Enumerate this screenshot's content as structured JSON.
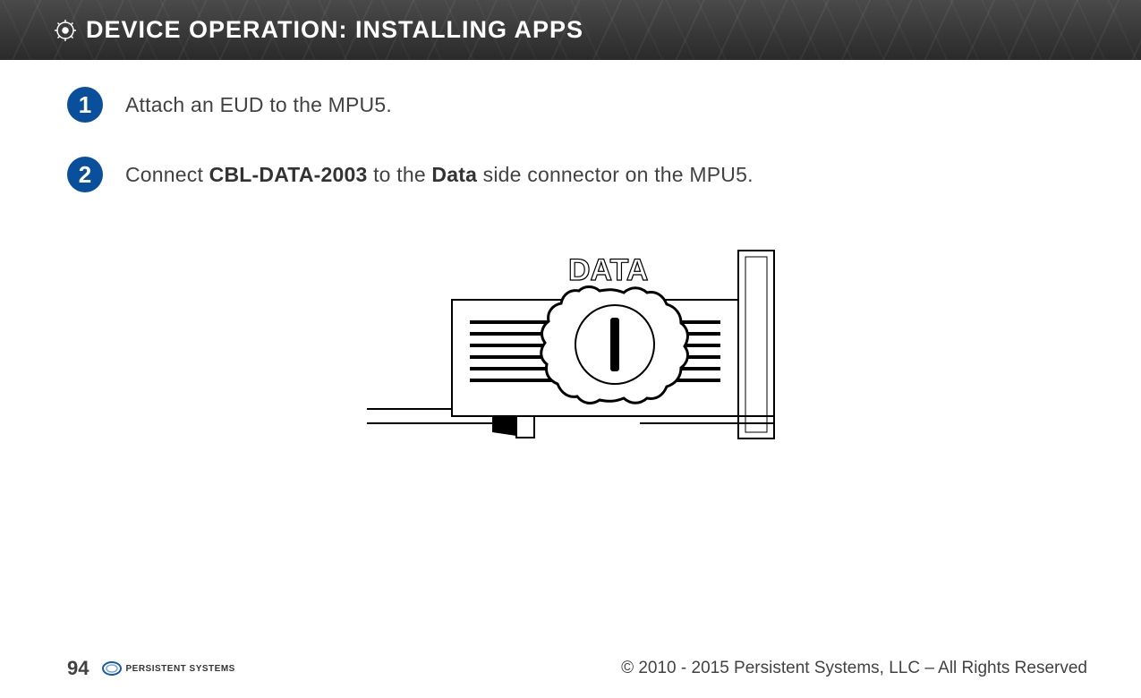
{
  "header": {
    "title": "DEVICE OPERATION:  INSTALLING APPS"
  },
  "steps": [
    {
      "num": "1",
      "text_plain": "Attach an EUD to the MPU5."
    },
    {
      "num": "2",
      "text_prefix": "Connect ",
      "bold1": "CBL-DATA-2003",
      "mid": " to the ",
      "bold2": "Data",
      "suffix": " side connector on the MPU5."
    }
  ],
  "diagram": {
    "label": "DATA"
  },
  "footer": {
    "page": "94",
    "brand": "PERSISTENT SYSTEMS",
    "copyright": "© 2010 - 2015 Persistent Systems, LLC – All Rights Reserved"
  }
}
